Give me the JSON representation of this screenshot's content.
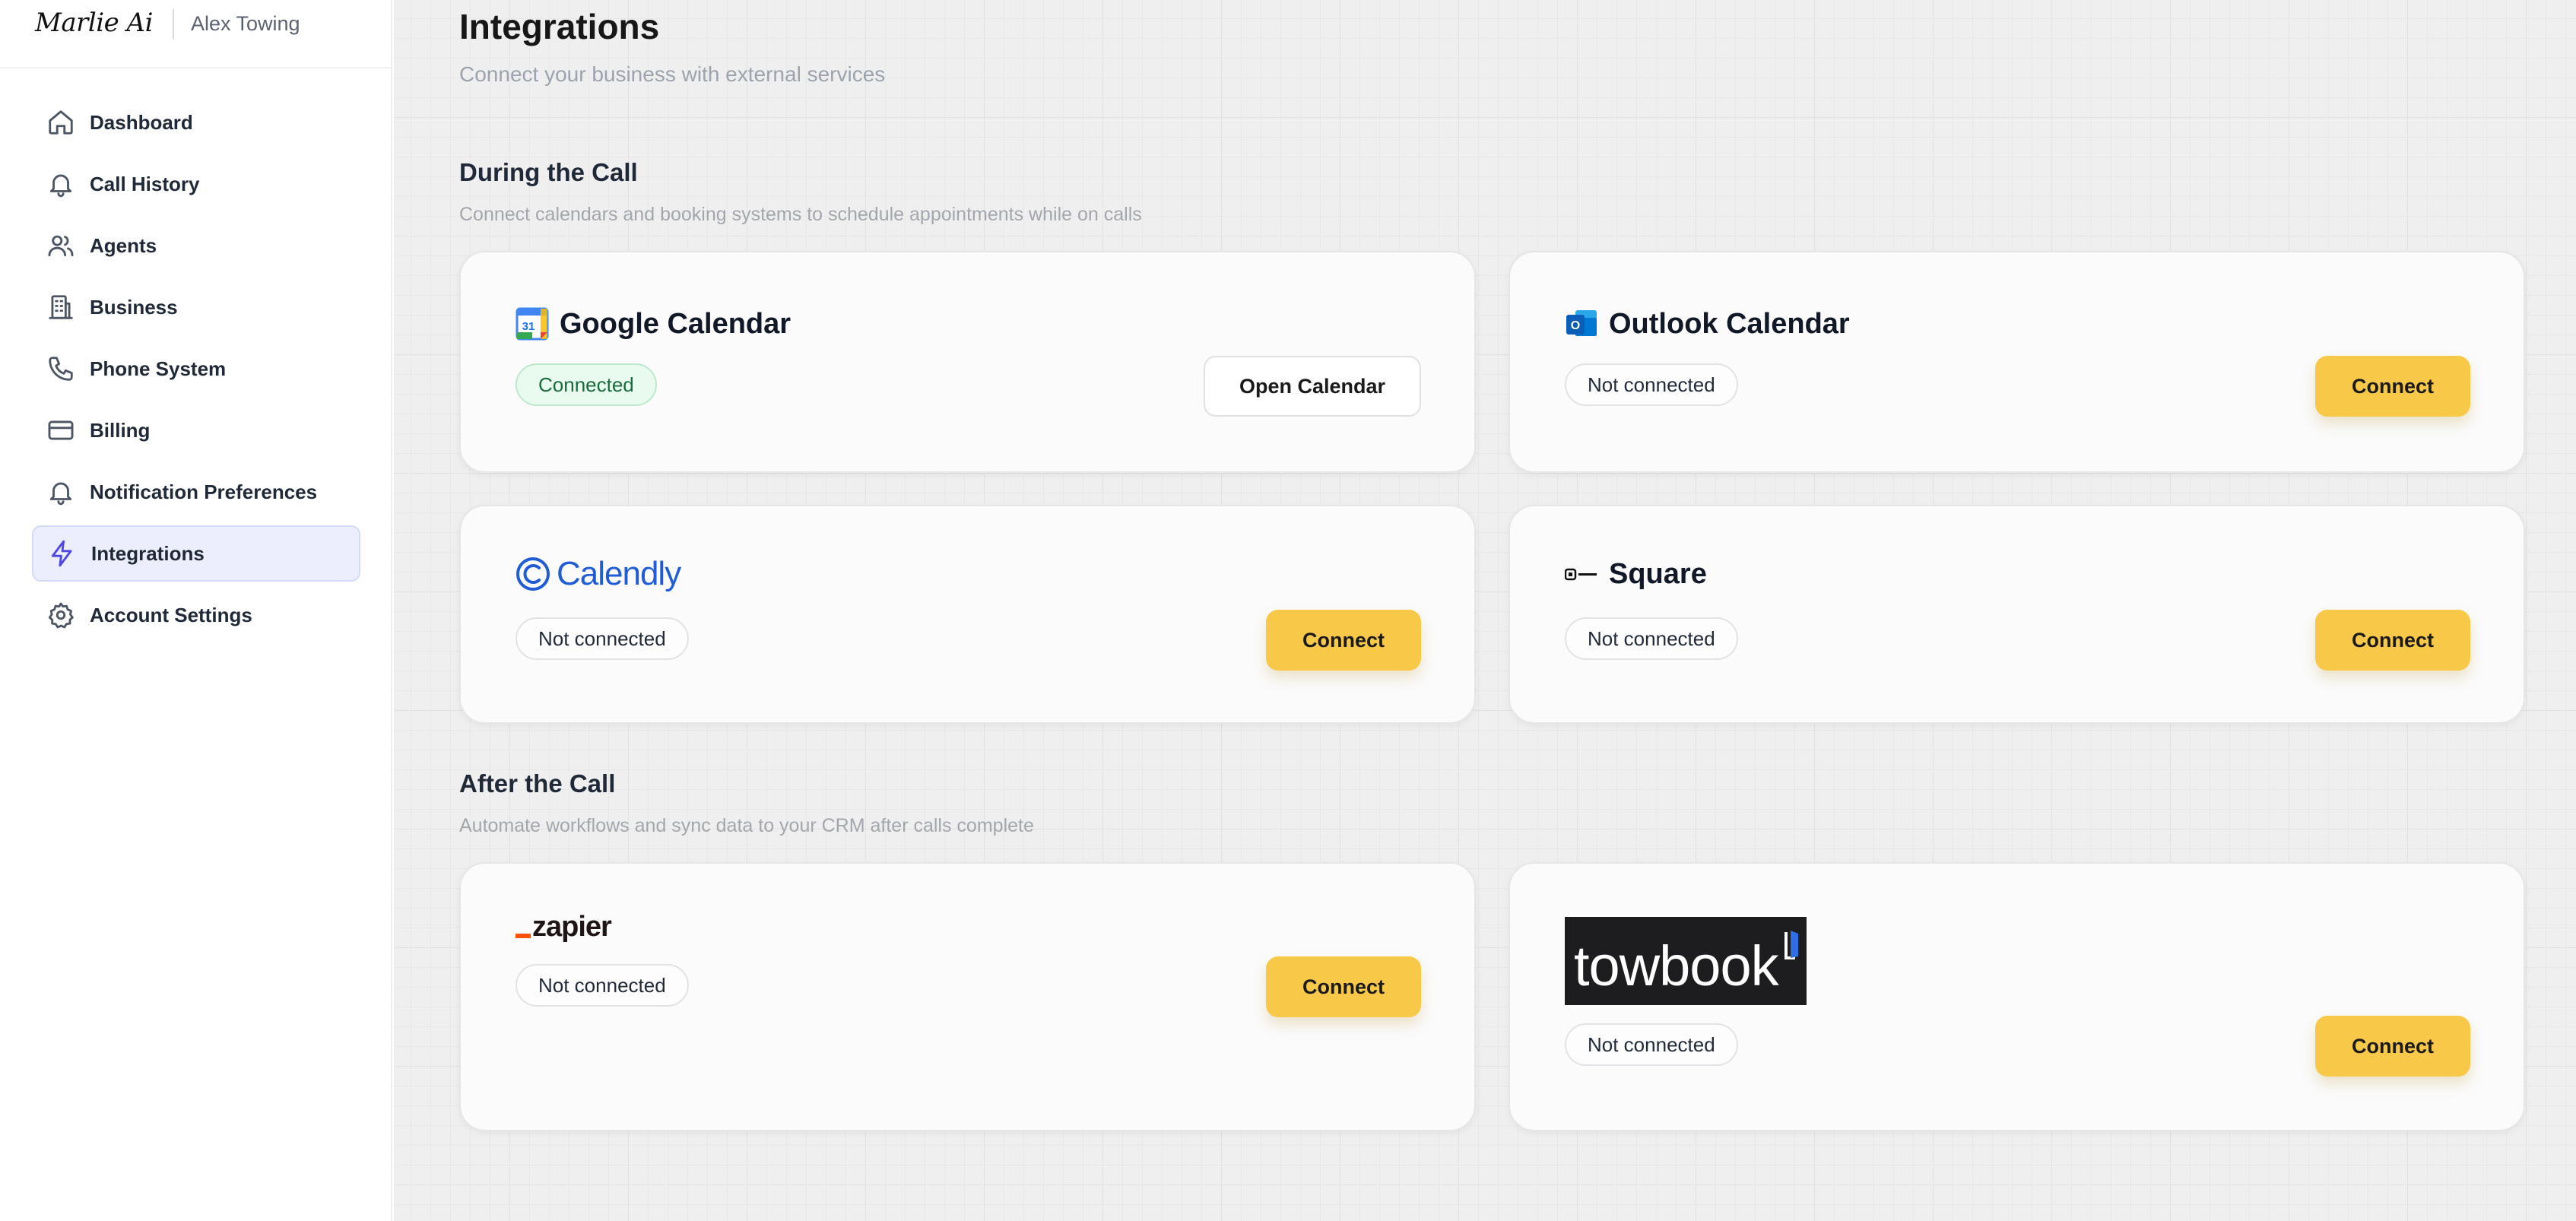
{
  "brand": {
    "logo": "Marlie Ai",
    "company": "Alex Towing"
  },
  "sidebar": {
    "items": [
      {
        "label": "Dashboard",
        "icon": "home-icon"
      },
      {
        "label": "Call History",
        "icon": "bell-icon"
      },
      {
        "label": "Agents",
        "icon": "users-icon"
      },
      {
        "label": "Business",
        "icon": "building-icon"
      },
      {
        "label": "Phone System",
        "icon": "phone-icon"
      },
      {
        "label": "Billing",
        "icon": "credit-card-icon"
      },
      {
        "label": "Notification Preferences",
        "icon": "bell-icon"
      },
      {
        "label": "Integrations",
        "icon": "lightning-icon",
        "active": true
      },
      {
        "label": "Account Settings",
        "icon": "gear-icon"
      }
    ]
  },
  "page": {
    "title": "Integrations",
    "subtitle": "Connect your business with external services"
  },
  "sections": {
    "during": {
      "title": "During the Call",
      "subtitle": "Connect calendars and booking systems to schedule appointments while on calls"
    },
    "after": {
      "title": "After the Call",
      "subtitle": "Automate workflows and sync data to your CRM after calls complete"
    }
  },
  "integrations": {
    "google": {
      "name": "Google Calendar",
      "icon_text": "31",
      "status": "Connected",
      "action": "Open Calendar"
    },
    "outlook": {
      "name": "Outlook Calendar",
      "icon_text": "O",
      "status": "Not connected",
      "action": "Connect"
    },
    "calendly": {
      "name": "Calendly",
      "status": "Not connected",
      "action": "Connect"
    },
    "square": {
      "name": "Square",
      "status": "Not connected",
      "action": "Connect"
    },
    "zapier": {
      "name": "zapier",
      "status": "Not connected",
      "action": "Connect"
    },
    "towbook": {
      "name": "towbook",
      "status": "Not connected",
      "action": "Connect"
    }
  },
  "colors": {
    "accent_button": "#f8c948",
    "active_nav_bg": "#eceefd",
    "connected_badge": "#e9fbef"
  }
}
